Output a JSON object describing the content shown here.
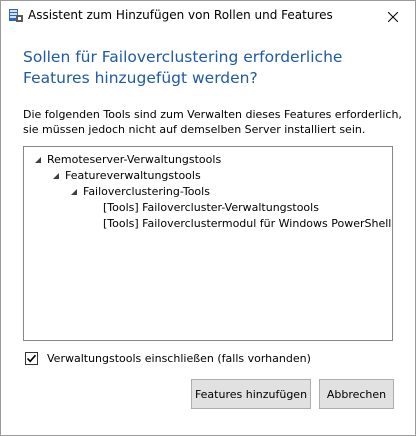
{
  "window": {
    "title": "Assistent zum Hinzufügen von Rollen und Features",
    "icon": "server-manager-icon"
  },
  "dialog": {
    "heading": "Sollen für Failoverclustering erforderliche Features hinzugefügt werden?",
    "description": "Die folgenden Tools sind zum Verwalten dieses Features erforderlich, sie müssen jedoch nicht auf demselben Server installiert sein.",
    "tree": [
      {
        "label": "Remoteserver-Verwaltungstools",
        "level": 0,
        "expanded": true
      },
      {
        "label": "Featureverwaltungstools",
        "level": 1,
        "expanded": true
      },
      {
        "label": "Failoverclustering-Tools",
        "level": 2,
        "expanded": true
      },
      {
        "label": "[Tools] Failovercluster-Verwaltungstools",
        "level": 3,
        "expanded": false
      },
      {
        "label": "[Tools] Failoverclustermodul für Windows PowerShell",
        "level": 3,
        "expanded": false
      }
    ],
    "include_tools": {
      "label": "Verwaltungstools einschließen (falls vorhanden)",
      "checked": true
    },
    "buttons": {
      "add": "Features hinzufügen",
      "cancel": "Abbrechen"
    }
  },
  "colors": {
    "heading": "#1e5aa8",
    "button_bg": "#e1e1e1",
    "border": "#828790"
  }
}
